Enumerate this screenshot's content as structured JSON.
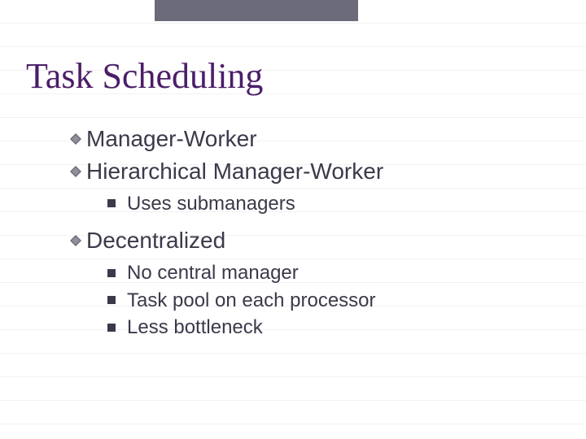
{
  "title": "Task Scheduling",
  "items": [
    {
      "label": "Manager-Worker",
      "sub": []
    },
    {
      "label": "Hierarchical Manager-Worker",
      "sub": [
        "Uses submanagers"
      ]
    },
    {
      "label": "Decentralized",
      "sub": [
        "No central manager",
        "Task pool on each processor",
        "Less bottleneck"
      ]
    }
  ]
}
